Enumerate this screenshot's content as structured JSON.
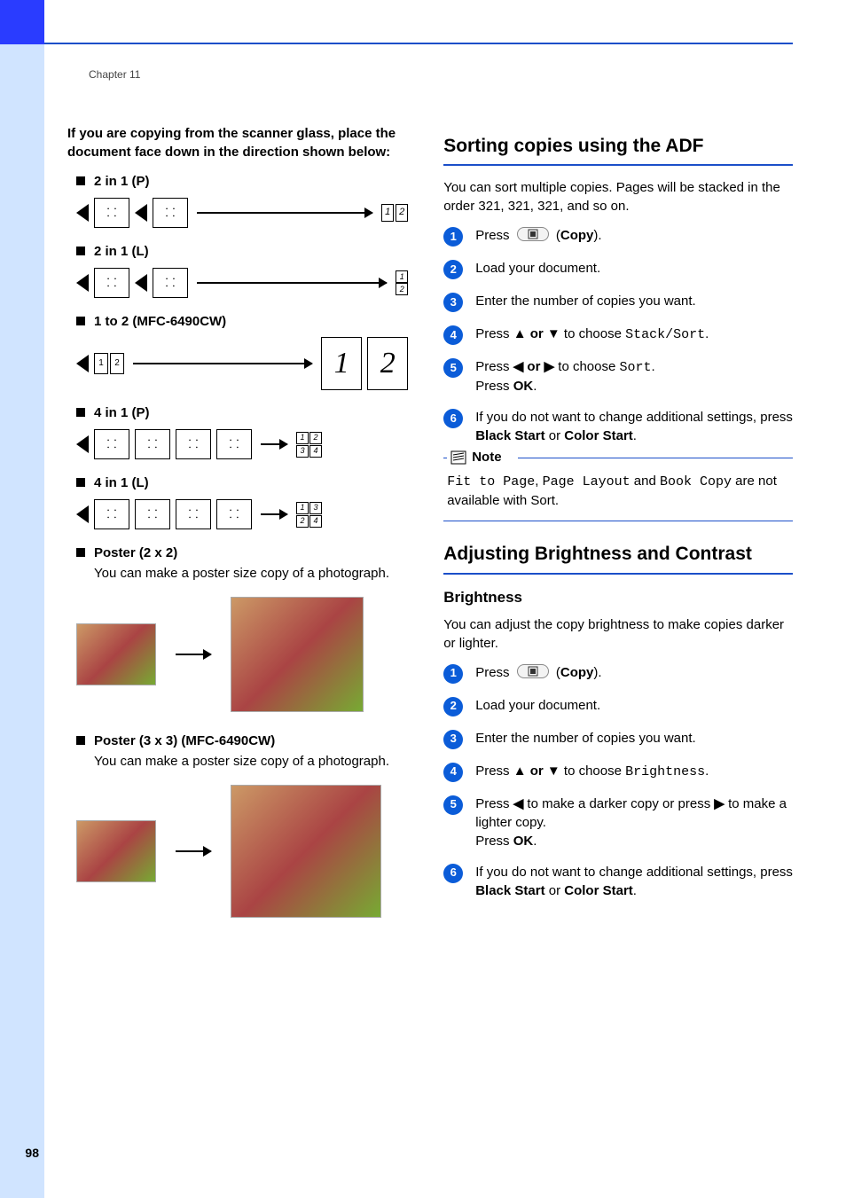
{
  "header": {
    "chapter": "Chapter 11",
    "page_number": "98"
  },
  "left": {
    "intro": "If you are copying from the scanner glass, place the document face down in the direction shown below:",
    "layouts": {
      "l1": "2 in 1 (P)",
      "l2": "2 in 1 (L)",
      "l3": "1 to 2 (MFC-6490CW)",
      "l4": "4 in 1 (P)",
      "l5": "4 in 1 (L)",
      "l6": "Poster (2 x 2)",
      "l6_desc": "You can make a poster size copy of a photograph.",
      "l7": "Poster (3 x 3) (MFC-6490CW)",
      "l7_desc": "You can make a poster size copy of a photograph."
    }
  },
  "right": {
    "section1": {
      "title": "Sorting copies using the ADF",
      "intro": "You can sort multiple copies. Pages will be stacked in the order 321, 321, 321, and so on.",
      "steps": {
        "s1a": "Press ",
        "s1b": " (",
        "s1c": "Copy",
        "s1d": ").",
        "s2": "Load your document.",
        "s3": "Enter the number of copies you want.",
        "s4a": "Press ",
        "s4arrows": "▲ or ▼",
        "s4b": " to choose ",
        "s4mono": "Stack/Sort",
        "s4c": ".",
        "s5a": "Press ",
        "s5arrows": "◀ or ▶",
        "s5b": " to choose ",
        "s5mono": "Sort",
        "s5c": ".",
        "s5d": "Press ",
        "s5ok": "OK",
        "s5e": ".",
        "s6a": "If you do not want to change additional settings, press ",
        "s6b": "Black Start",
        "s6c": " or ",
        "s6d": "Color Start",
        "s6e": "."
      },
      "note": {
        "label": "Note",
        "m1": "Fit to Page",
        "t1": ", ",
        "m2": "Page Layout",
        "t2": " and ",
        "m3": "Book Copy",
        "t3": " are not available with Sort."
      }
    },
    "section2": {
      "title": "Adjusting Brightness and Contrast",
      "sub": "Brightness",
      "intro": "You can adjust the copy brightness to make copies darker or lighter.",
      "steps": {
        "s1a": "Press ",
        "s1b": " (",
        "s1c": "Copy",
        "s1d": ").",
        "s2": "Load your document.",
        "s3": "Enter the number of copies you want.",
        "s4a": "Press ",
        "s4arrows": "▲ or ▼",
        "s4b": " to choose ",
        "s4mono": "Brightness",
        "s4c": ".",
        "s5a": "Press ",
        "s5l": "◀",
        "s5b": " to make a darker copy or press ",
        "s5r": "▶",
        "s5c": " to make a lighter copy.",
        "s5d": "Press ",
        "s5ok": "OK",
        "s5e": ".",
        "s6a": "If you do not want to change additional settings, press ",
        "s6b": "Black Start",
        "s6c": " or ",
        "s6d": "Color Start",
        "s6e": "."
      }
    }
  }
}
